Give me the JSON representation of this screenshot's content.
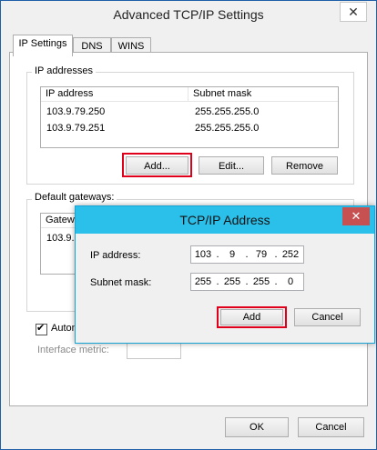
{
  "window": {
    "title": "Advanced TCP/IP Settings",
    "close_glyph": "✕"
  },
  "tabs": [
    {
      "label": "IP Settings"
    },
    {
      "label": "DNS"
    },
    {
      "label": "WINS"
    }
  ],
  "ip_addresses": {
    "group_label": "IP addresses",
    "columns": [
      "IP address",
      "Subnet mask"
    ],
    "rows": [
      [
        "103.9.79.250",
        "255.255.255.0"
      ],
      [
        "103.9.79.251",
        "255.255.255.0"
      ]
    ],
    "buttons": {
      "add": "Add...",
      "edit": "Edit...",
      "remove": "Remove"
    }
  },
  "gateways": {
    "group_label": "Default gateways:",
    "column_partial": "Gatew",
    "row_partial": "103.9."
  },
  "auto_metric": {
    "label_partial": "Autom",
    "checked": true,
    "check_glyph": "✔"
  },
  "interface_metric": {
    "label": "Interface metric:"
  },
  "footer": {
    "ok": "OK",
    "cancel": "Cancel"
  },
  "dialog": {
    "title": "TCP/IP Address",
    "close_glyph": "✕",
    "ip_label": "IP address:",
    "ip_octets": [
      "103",
      "9",
      "79",
      "252"
    ],
    "mask_label": "Subnet mask:",
    "mask_octets": [
      "255",
      "255",
      "255",
      "0"
    ],
    "add": "Add",
    "cancel": "Cancel"
  },
  "colors": {
    "highlight": "#e0001c",
    "dialog_titlebar": "#2bc0ea",
    "close_red": "#c75050"
  }
}
